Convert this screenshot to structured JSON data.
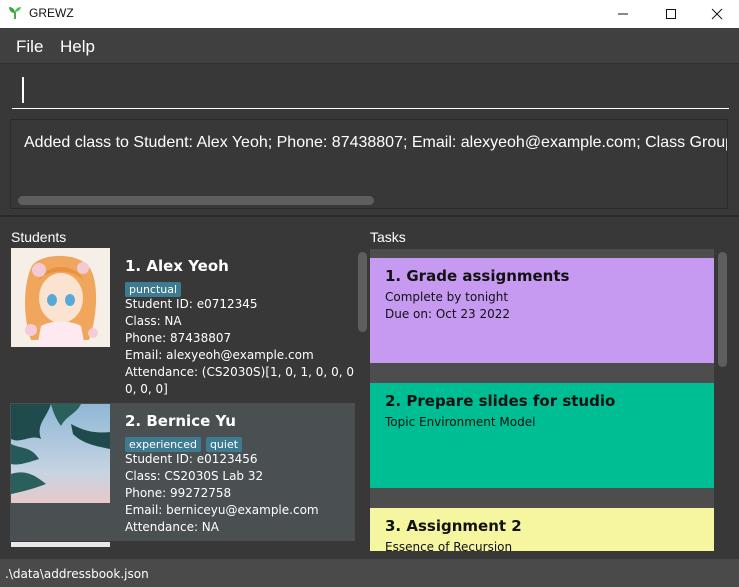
{
  "window": {
    "title": "GREWZ",
    "minimize_glyph": "—",
    "maximize_glyph": "☐",
    "close_glyph": "✕"
  },
  "menu": [
    "File",
    "Help"
  ],
  "command": {
    "value": ""
  },
  "result": {
    "text": "Added class to Student: Alex Yeoh; Phone: 87438807; Email: alexyeoh@example.com; Class Group"
  },
  "panels": {
    "students_header": "Students",
    "tasks_header": "Tasks"
  },
  "students": [
    {
      "number": "1.",
      "name": "Alex Yeoh",
      "tags": [
        "punctual"
      ],
      "student_id": "Student ID: e0712345",
      "class": "Class: NA",
      "phone": "Phone: 87438807",
      "email": "Email: alexyeoh@example.com",
      "attendance_1": "Attendance: (CS2030S)[1, 0, 1, 0, 0, 0, 0,",
      "attendance_2": "0, 0, 0]",
      "avatar_icon": "anime-girl-avatar"
    },
    {
      "number": "2.",
      "name": "Bernice Yu",
      "tags": [
        "experienced",
        "quiet"
      ],
      "student_id": "Student ID: e0123456",
      "class": "Class: CS2030S Lab 32",
      "phone": "Phone: 99272758",
      "email": "Email: berniceyu@example.com",
      "attendance": "Attendance: NA",
      "avatar_icon": "tree-sky-avatar"
    }
  ],
  "tasks": [
    {
      "number": "1.",
      "title": "Grade assignments",
      "desc": "Complete by tonight",
      "due": "Due on: Oct 23 2022",
      "color": "#c79af2"
    },
    {
      "number": "2.",
      "title": "Prepare slides for studio",
      "desc": "Topic Environment Model",
      "color": "#00be94"
    },
    {
      "number": "3.",
      "title": "Assignment 2",
      "desc": "Essence of Recursion",
      "color": "#f6f5a0"
    }
  ],
  "status": {
    "path": ".\\data\\addressbook.json"
  }
}
